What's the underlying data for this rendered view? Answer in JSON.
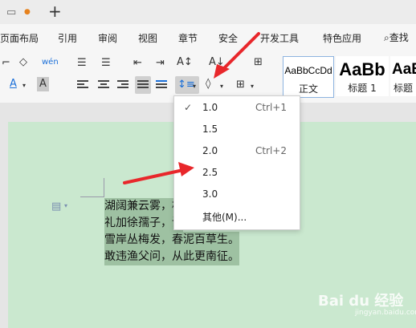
{
  "menubar": {
    "items": [
      "页面布局",
      "引用",
      "审阅",
      "视图",
      "章节",
      "安全",
      "开发工具",
      "特色应用"
    ],
    "search": "查找"
  },
  "toolbar": {
    "font_glyph": "A",
    "wen_glyph": "wén",
    "styles": [
      {
        "sample": "AaBbCcDd",
        "name": "正文"
      },
      {
        "sample": "AaBb",
        "name": "标题 1"
      },
      {
        "sample": "AaB",
        "name": "标题"
      }
    ]
  },
  "document": {
    "lines": [
      "湖阔兼云雾，相",
      "礼加徐孺子，诗",
      "雪岸丛梅发，春泥百草生。",
      "敢违渔父问，从此更南征。"
    ]
  },
  "line_spacing_menu": {
    "items": [
      {
        "label": "1.0",
        "shortcut": "Ctrl+1",
        "checked": true
      },
      {
        "label": "1.5",
        "shortcut": "",
        "checked": false
      },
      {
        "label": "2.0",
        "shortcut": "Ctrl+2",
        "checked": false
      },
      {
        "label": "2.5",
        "shortcut": "",
        "checked": false
      },
      {
        "label": "3.0",
        "shortcut": "",
        "checked": false
      },
      {
        "label": "其他(M)...",
        "shortcut": "",
        "checked": false
      }
    ]
  },
  "watermark": {
    "text": "Bai du 经验",
    "sub": "jingyan.baidu.com"
  },
  "colors": {
    "page": "#cae8cf",
    "highlight": "#9ec1a2",
    "arrow": "#e8272b",
    "accent": "#1a6fd8"
  }
}
